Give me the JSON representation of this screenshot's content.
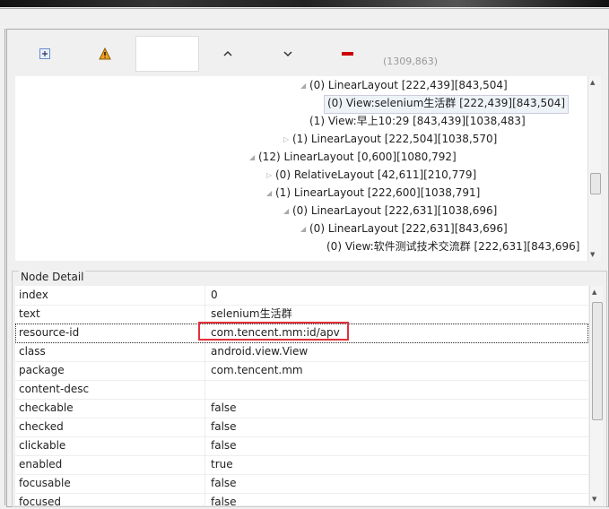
{
  "toolbar": {
    "coords": "(1309,863)",
    "icons": [
      "expand-all-icon",
      "warning-icon",
      "blank-field",
      "up-icon",
      "down-icon",
      "remove-icon"
    ]
  },
  "tree": [
    {
      "label": "(0) LinearLayout [222,439][843,504]",
      "state": "expanded"
    },
    {
      "label": "(0) View:selenium生活群 [222,439][843,504]",
      "state": "leaf",
      "selected": true
    },
    {
      "label": "(1) View:早上10:29 [843,439][1038,483]",
      "state": "leaf"
    },
    {
      "label": "(1) LinearLayout [222,504][1038,570]",
      "state": "collapsed"
    },
    {
      "label": "(12) LinearLayout [0,600][1080,792]",
      "state": "expanded"
    },
    {
      "label": "(0) RelativeLayout [42,611][210,779]",
      "state": "collapsed"
    },
    {
      "label": "(1) LinearLayout [222,600][1038,791]",
      "state": "expanded"
    },
    {
      "label": "(0) LinearLayout [222,631][1038,696]",
      "state": "expanded"
    },
    {
      "label": "(0) LinearLayout [222,631][843,696]",
      "state": "expanded"
    },
    {
      "label": "(0) View:软件测试技术交流群 [222,631][843,696]",
      "state": "leaf"
    }
  ],
  "detail": {
    "title": "Node Detail",
    "rows": [
      {
        "key": "index",
        "value": "0"
      },
      {
        "key": "text",
        "value": "selenium生活群"
      },
      {
        "key": "resource-id",
        "value": "com.tencent.mm:id/apv"
      },
      {
        "key": "class",
        "value": "android.view.View"
      },
      {
        "key": "package",
        "value": "com.tencent.mm"
      },
      {
        "key": "content-desc",
        "value": ""
      },
      {
        "key": "checkable",
        "value": "false"
      },
      {
        "key": "checked",
        "value": "false"
      },
      {
        "key": "clickable",
        "value": "false"
      },
      {
        "key": "enabled",
        "value": "true"
      },
      {
        "key": "focusable",
        "value": "false"
      },
      {
        "key": "focused",
        "value": "false"
      }
    ]
  },
  "colors": {
    "highlight": "#e3303a",
    "warning": "#f0a020",
    "remove": "#cc0000"
  }
}
